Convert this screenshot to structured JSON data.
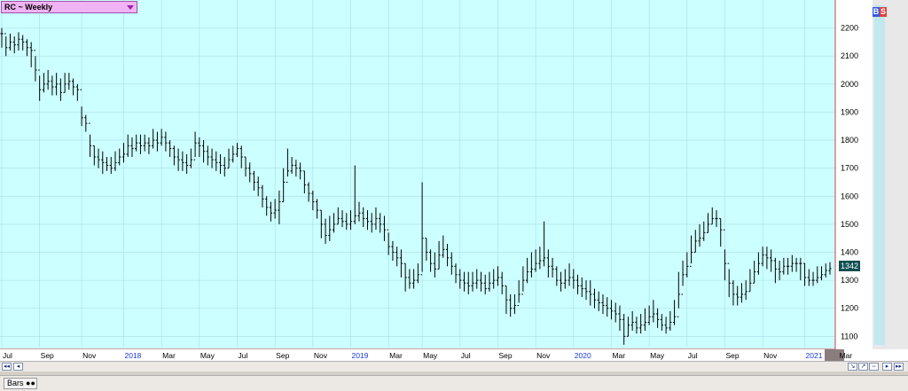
{
  "window": {
    "title": "RC ~ Weekly",
    "buttons": {
      "buy": "B",
      "sell": "S"
    },
    "status_label": "Bars"
  },
  "colors": {
    "plot_bg": "#ccffff",
    "bars": "#000000",
    "grid": "#a8dde8",
    "axis_line": "#d04040",
    "date_axis_year": "#1a3ad8",
    "price_tag_bg": "#0f4f4f",
    "title_bg": "#f0b4f4"
  },
  "chart_data": {
    "type": "ohlc-bar",
    "title": "RC ~ Weekly",
    "xlabel": "",
    "ylabel": "",
    "ylim": [
      1060,
      2300
    ],
    "grid": true,
    "last_price": "1342",
    "y_ticks": [
      1100,
      1200,
      1300,
      1400,
      1500,
      1600,
      1700,
      1800,
      1900,
      2000,
      2100,
      2200
    ],
    "x_ticks": [
      {
        "label": "Jul",
        "year": false,
        "bar": 0
      },
      {
        "label": "Sep",
        "year": false,
        "bar": 9
      },
      {
        "label": "Nov",
        "year": false,
        "bar": 19
      },
      {
        "label": "2018",
        "year": true,
        "bar": 29
      },
      {
        "label": "Mar",
        "year": false,
        "bar": 38
      },
      {
        "label": "May",
        "year": false,
        "bar": 47
      },
      {
        "label": "Jul",
        "year": false,
        "bar": 56
      },
      {
        "label": "Sep",
        "year": false,
        "bar": 65
      },
      {
        "label": "Nov",
        "year": false,
        "bar": 74
      },
      {
        "label": "2019",
        "year": true,
        "bar": 83
      },
      {
        "label": "Mar",
        "year": false,
        "bar": 92
      },
      {
        "label": "May",
        "year": false,
        "bar": 100
      },
      {
        "label": "Jul",
        "year": false,
        "bar": 109
      },
      {
        "label": "Sep",
        "year": false,
        "bar": 118
      },
      {
        "label": "Nov",
        "year": false,
        "bar": 127
      },
      {
        "label": "2020",
        "year": true,
        "bar": 136
      },
      {
        "label": "Mar",
        "year": false,
        "bar": 145
      },
      {
        "label": "May",
        "year": false,
        "bar": 154
      },
      {
        "label": "Jul",
        "year": false,
        "bar": 163
      },
      {
        "label": "Sep",
        "year": false,
        "bar": 172
      },
      {
        "label": "Nov",
        "year": false,
        "bar": 181
      },
      {
        "label": "2021",
        "year": true,
        "bar": 191
      },
      {
        "label": "Mar",
        "year": false,
        "bar": 199
      }
    ],
    "close": [
      2180,
      2130,
      2150,
      2140,
      2160,
      2150,
      2130,
      2120,
      2050,
      1980,
      2000,
      2010,
      1990,
      2000,
      1970,
      2000,
      2010,
      1990,
      1980,
      1880,
      1860,
      1780,
      1740,
      1730,
      1720,
      1710,
      1700,
      1720,
      1740,
      1750,
      1780,
      1770,
      1790,
      1780,
      1790,
      1780,
      1800,
      1790,
      1810,
      1790,
      1770,
      1740,
      1730,
      1720,
      1710,
      1730,
      1790,
      1780,
      1760,
      1740,
      1730,
      1720,
      1710,
      1700,
      1730,
      1750,
      1770,
      1740,
      1700,
      1680,
      1650,
      1630,
      1590,
      1560,
      1540,
      1550,
      1580,
      1650,
      1690,
      1710,
      1700,
      1690,
      1640,
      1610,
      1580,
      1550,
      1500,
      1460,
      1480,
      1500,
      1520,
      1510,
      1500,
      1510,
      1530,
      1540,
      1520,
      1510,
      1500,
      1520,
      1500,
      1480,
      1420,
      1400,
      1380,
      1360,
      1310,
      1290,
      1300,
      1320,
      1450,
      1400,
      1360,
      1340,
      1390,
      1410,
      1380,
      1350,
      1320,
      1300,
      1290,
      1280,
      1290,
      1300,
      1290,
      1270,
      1290,
      1300,
      1310,
      1280,
      1230,
      1200,
      1210,
      1250,
      1300,
      1330,
      1340,
      1360,
      1370,
      1380,
      1350,
      1340,
      1300,
      1290,
      1300,
      1310,
      1300,
      1280,
      1270,
      1260,
      1250,
      1230,
      1220,
      1210,
      1200,
      1190,
      1180,
      1160,
      1100,
      1140,
      1150,
      1130,
      1140,
      1150,
      1170,
      1180,
      1160,
      1140,
      1130,
      1150,
      1170,
      1250,
      1320,
      1350,
      1400,
      1440,
      1450,
      1470,
      1500,
      1520,
      1520,
      1480,
      1360,
      1290,
      1250,
      1240,
      1250,
      1260,
      1290,
      1330,
      1360,
      1390,
      1380,
      1370,
      1340,
      1330,
      1350,
      1350,
      1360,
      1360,
      1360,
      1310,
      1300,
      1300,
      1310,
      1320,
      1335,
      1342
    ],
    "high": [
      2200,
      2170,
      2180,
      2170,
      2185,
      2175,
      2160,
      2150,
      2100,
      2030,
      2040,
      2050,
      2030,
      2040,
      2020,
      2040,
      2040,
      2020,
      2000,
      1920,
      1890,
      1820,
      1780,
      1770,
      1760,
      1740,
      1740,
      1760,
      1770,
      1790,
      1820,
      1810,
      1820,
      1820,
      1820,
      1810,
      1840,
      1830,
      1840,
      1830,
      1800,
      1780,
      1770,
      1760,
      1750,
      1770,
      1830,
      1810,
      1800,
      1780,
      1770,
      1760,
      1750,
      1740,
      1770,
      1780,
      1790,
      1780,
      1740,
      1720,
      1690,
      1670,
      1640,
      1600,
      1580,
      1590,
      1620,
      1700,
      1770,
      1740,
      1730,
      1720,
      1690,
      1650,
      1620,
      1590,
      1550,
      1520,
      1530,
      1540,
      1560,
      1550,
      1540,
      1550,
      1710,
      1580,
      1560,
      1550,
      1540,
      1560,
      1540,
      1530,
      1470,
      1440,
      1420,
      1410,
      1360,
      1340,
      1340,
      1360,
      1650,
      1450,
      1410,
      1400,
      1440,
      1460,
      1430,
      1400,
      1360,
      1340,
      1330,
      1330,
      1330,
      1340,
      1330,
      1320,
      1330,
      1340,
      1350,
      1330,
      1280,
      1250,
      1250,
      1300,
      1350,
      1380,
      1400,
      1410,
      1420,
      1510,
      1410,
      1380,
      1350,
      1330,
      1340,
      1360,
      1340,
      1320,
      1310,
      1300,
      1300,
      1270,
      1260,
      1250,
      1240,
      1230,
      1220,
      1210,
      1180,
      1170,
      1190,
      1170,
      1180,
      1200,
      1210,
      1230,
      1200,
      1180,
      1170,
      1190,
      1230,
      1330,
      1370,
      1400,
      1460,
      1480,
      1500,
      1510,
      1540,
      1560,
      1550,
      1520,
      1410,
      1340,
      1300,
      1280,
      1290,
      1300,
      1340,
      1370,
      1400,
      1420,
      1420,
      1410,
      1380,
      1370,
      1380,
      1380,
      1390,
      1380,
      1380,
      1360,
      1340,
      1330,
      1350,
      1350,
      1360,
      1365
    ],
    "low": [
      2130,
      2100,
      2120,
      2110,
      2120,
      2120,
      2100,
      2060,
      2010,
      1940,
      1970,
      1980,
      1960,
      1960,
      1940,
      1970,
      1980,
      1960,
      1940,
      1850,
      1830,
      1740,
      1710,
      1700,
      1680,
      1690,
      1680,
      1690,
      1710,
      1720,
      1740,
      1740,
      1760,
      1750,
      1760,
      1750,
      1770,
      1760,
      1780,
      1760,
      1740,
      1710,
      1690,
      1690,
      1680,
      1700,
      1740,
      1740,
      1720,
      1710,
      1700,
      1690,
      1680,
      1670,
      1700,
      1720,
      1740,
      1700,
      1670,
      1650,
      1620,
      1600,
      1560,
      1530,
      1510,
      1520,
      1500,
      1580,
      1670,
      1680,
      1670,
      1660,
      1610,
      1580,
      1550,
      1520,
      1450,
      1430,
      1440,
      1470,
      1500,
      1490,
      1480,
      1480,
      1500,
      1510,
      1490,
      1480,
      1470,
      1480,
      1470,
      1440,
      1390,
      1370,
      1350,
      1310,
      1260,
      1270,
      1270,
      1290,
      1330,
      1370,
      1330,
      1310,
      1340,
      1380,
      1350,
      1320,
      1290,
      1270,
      1260,
      1250,
      1260,
      1270,
      1260,
      1250,
      1260,
      1270,
      1280,
      1250,
      1180,
      1170,
      1180,
      1220,
      1260,
      1290,
      1310,
      1330,
      1340,
      1350,
      1310,
      1310,
      1280,
      1260,
      1270,
      1280,
      1270,
      1250,
      1240,
      1230,
      1210,
      1200,
      1190,
      1180,
      1170,
      1160,
      1150,
      1120,
      1070,
      1100,
      1120,
      1110,
      1110,
      1120,
      1140,
      1150,
      1130,
      1120,
      1110,
      1120,
      1140,
      1200,
      1280,
      1310,
      1360,
      1400,
      1420,
      1440,
      1470,
      1500,
      1490,
      1420,
      1300,
      1240,
      1210,
      1210,
      1220,
      1230,
      1260,
      1290,
      1320,
      1350,
      1340,
      1330,
      1290,
      1300,
      1320,
      1320,
      1330,
      1330,
      1300,
      1280,
      1280,
      1280,
      1290,
      1300,
      1310,
      1320
    ]
  }
}
